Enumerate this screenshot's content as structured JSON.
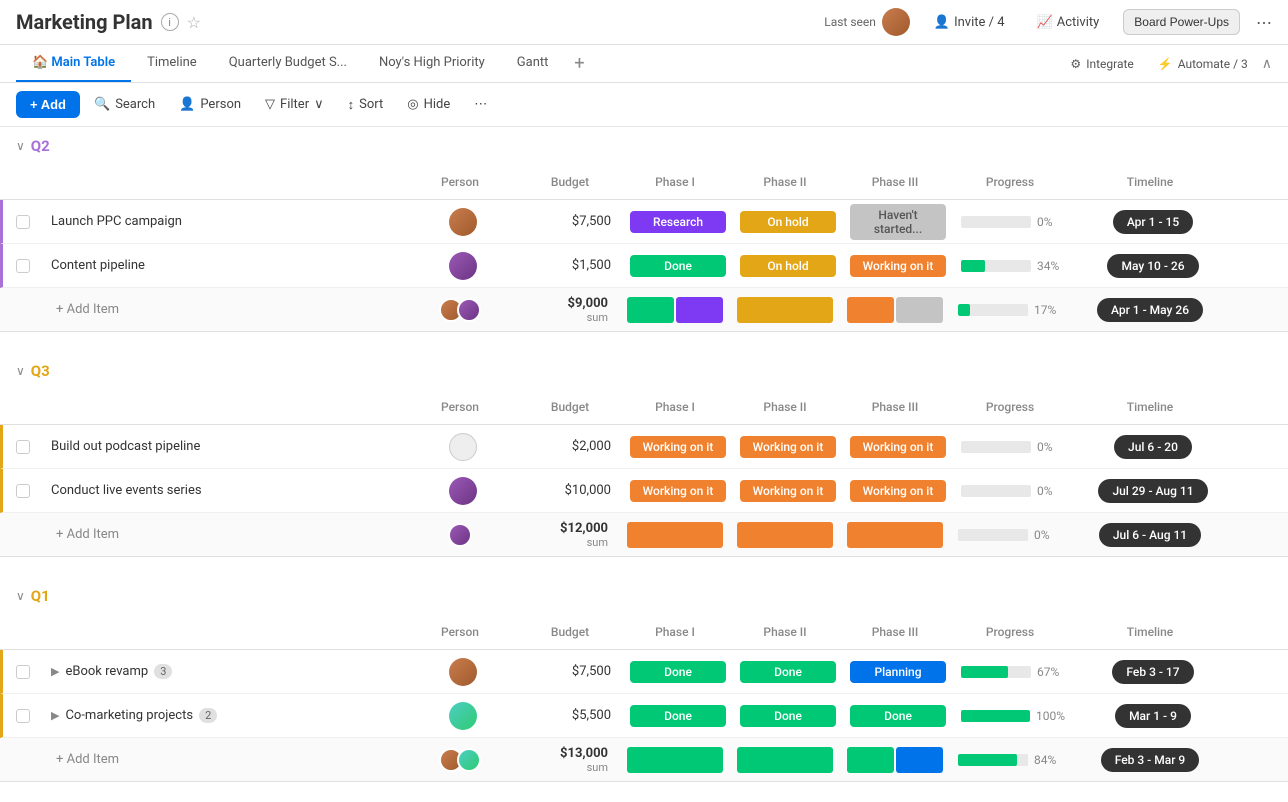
{
  "app": {
    "title": "Marketing Plan",
    "last_seen_label": "Last seen",
    "invite_label": "Invite / 4",
    "activity_label": "Activity",
    "board_power_ups_label": "Board Power-Ups"
  },
  "tabs": {
    "items": [
      {
        "label": "Main Table",
        "active": true,
        "icon": "home"
      },
      {
        "label": "Timeline",
        "active": false
      },
      {
        "label": "Quarterly Budget S...",
        "active": false
      },
      {
        "label": "Noy's High Priority",
        "active": false
      },
      {
        "label": "Gantt",
        "active": false
      }
    ],
    "integrate_label": "Integrate",
    "automate_label": "Automate / 3"
  },
  "toolbar": {
    "add_label": "+ Add",
    "search_label": "Search",
    "person_label": "Person",
    "filter_label": "Filter",
    "sort_label": "Sort",
    "hide_label": "Hide"
  },
  "groups": [
    {
      "id": "q2",
      "label": "Q2",
      "color_class": "q2",
      "border_color": "#a971d8",
      "columns": [
        "Person",
        "Budget",
        "Phase I",
        "Phase II",
        "Phase III",
        "Progress",
        "Timeline"
      ],
      "rows": [
        {
          "name": "Launch PPC campaign",
          "avatar_class": "av-brown",
          "budget": "$7,500",
          "phase1": "Research",
          "phase1_class": "purple",
          "phase2": "On hold",
          "phase2_class": "yellow",
          "phase3": "Haven't started...",
          "phase3_class": "gray",
          "progress": 0,
          "progress_label": "0%",
          "timeline": "Apr 1 - 15"
        },
        {
          "name": "Content pipeline",
          "avatar_class": "av-purple",
          "budget": "$1,500",
          "phase1": "Done",
          "phase1_class": "green",
          "phase2": "On hold",
          "phase2_class": "yellow",
          "phase3": "Working on it",
          "phase3_class": "orange",
          "progress": 34,
          "progress_label": "34%",
          "timeline": "May 10 - 26"
        }
      ],
      "summary": {
        "budget": "$9,000",
        "budget_sub": "sum",
        "progress": 17,
        "progress_label": "17%",
        "timeline": "Apr 1 - May 26",
        "phase1_colors": [
          "#00c875",
          "#7e3af2"
        ],
        "phase2_colors": [
          "#e2a617"
        ],
        "phase3_colors": [
          "#f0812e",
          "#c4c4c4"
        ]
      }
    },
    {
      "id": "q3",
      "label": "Q3",
      "color_class": "q3",
      "border_color": "#e2a617",
      "columns": [
        "Person",
        "Budget",
        "Phase I",
        "Phase II",
        "Phase III",
        "Progress",
        "Timeline"
      ],
      "rows": [
        {
          "name": "Build out podcast pipeline",
          "avatar_class": "av-outline",
          "budget": "$2,000",
          "phase1": "Working on it",
          "phase1_class": "orange",
          "phase2": "Working on it",
          "phase2_class": "orange",
          "phase3": "Working on it",
          "phase3_class": "orange",
          "progress": 0,
          "progress_label": "0%",
          "timeline": "Jul 6 - 20"
        },
        {
          "name": "Conduct live events series",
          "avatar_class": "av-purple",
          "budget": "$10,000",
          "phase1": "Working on it",
          "phase1_class": "orange",
          "phase2": "Working on it",
          "phase2_class": "orange",
          "phase3": "Working on it",
          "phase3_class": "orange",
          "progress": 0,
          "progress_label": "0%",
          "timeline": "Jul 29 - Aug 11"
        }
      ],
      "summary": {
        "budget": "$12,000",
        "budget_sub": "sum",
        "progress": 0,
        "progress_label": "0%",
        "timeline": "Jul 6 - Aug 11",
        "phase1_colors": [
          "#f0812e"
        ],
        "phase2_colors": [
          "#f0812e"
        ],
        "phase3_colors": [
          "#f0812e"
        ]
      }
    },
    {
      "id": "q1",
      "label": "Q1",
      "color_class": "q1",
      "border_color": "#e2a617",
      "columns": [
        "Person",
        "Budget",
        "Phase I",
        "Phase II",
        "Phase III",
        "Progress",
        "Timeline"
      ],
      "rows": [
        {
          "name": "eBook revamp",
          "badge": "3",
          "expandable": true,
          "avatar_class": "av-brown",
          "budget": "$7,500",
          "phase1": "Done",
          "phase1_class": "green",
          "phase2": "Done",
          "phase2_class": "green",
          "phase3": "Planning",
          "phase3_class": "blue",
          "progress": 67,
          "progress_label": "67%",
          "timeline": "Feb 3 - 17"
        },
        {
          "name": "Co-marketing projects",
          "badge": "2",
          "expandable": true,
          "avatar_class": "av-teal",
          "budget": "$5,500",
          "phase1": "Done",
          "phase1_class": "green",
          "phase2": "Done",
          "phase2_class": "green",
          "phase3": "Done",
          "phase3_class": "green",
          "progress": 100,
          "progress_label": "100%",
          "timeline": "Mar 1 - 9"
        }
      ],
      "summary": {
        "budget": "$13,000",
        "budget_sub": "sum",
        "progress": 84,
        "progress_label": "84%",
        "timeline": "Feb 3 - Mar 9",
        "phase1_colors": [
          "#00c875"
        ],
        "phase2_colors": [
          "#00c875"
        ],
        "phase3_colors": [
          "#00c875",
          "#0073ea"
        ]
      }
    }
  ],
  "column_headers": {
    "check": "",
    "name": "",
    "person": "Person",
    "budget": "Budget",
    "phase1": "Phase I",
    "phase2": "Phase II",
    "phase3": "Phase III",
    "progress": "Progress",
    "timeline": "Timeline"
  },
  "add_item_label": "+ Add Item"
}
